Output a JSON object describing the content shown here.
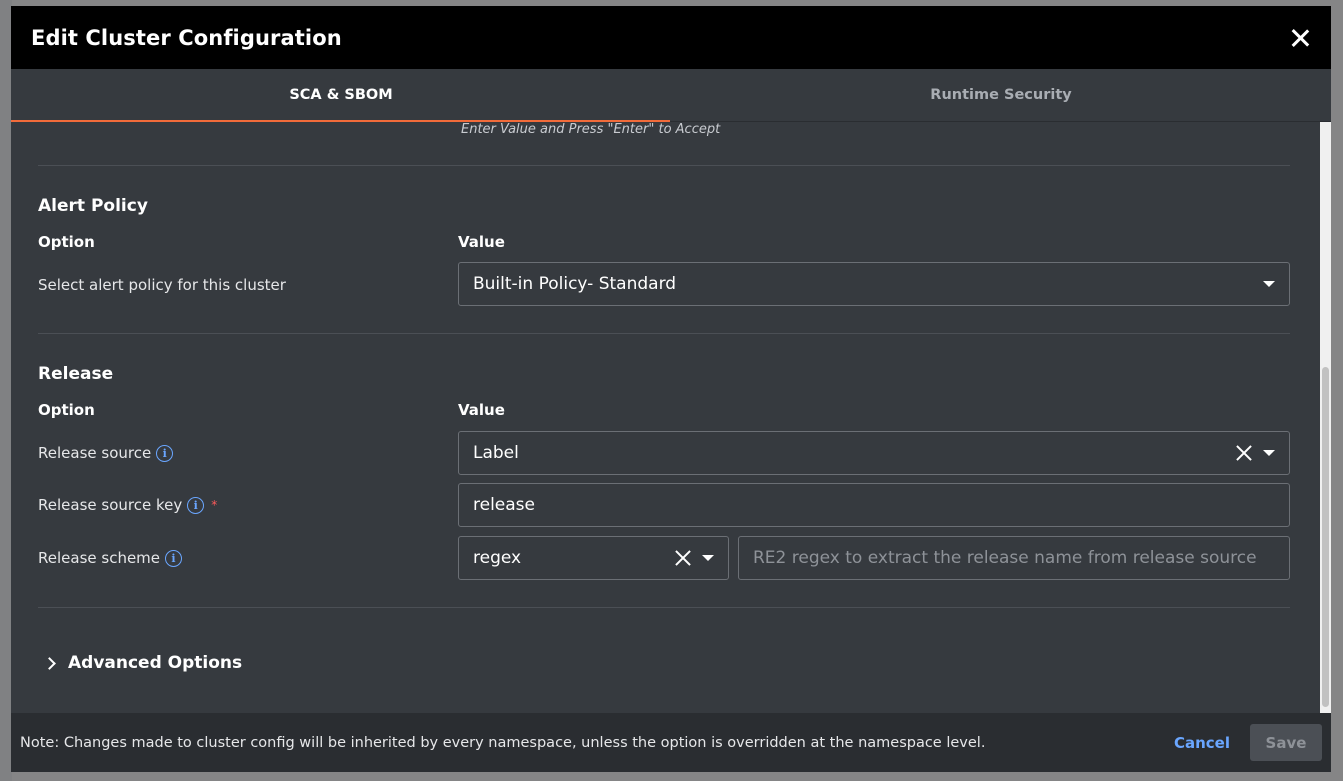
{
  "modal": {
    "title": "Edit Cluster Configuration"
  },
  "tabs": [
    {
      "label": "SCA & SBOM",
      "active": true
    },
    {
      "label": "Runtime Security",
      "active": false
    }
  ],
  "hint": "Enter Value and Press \"Enter\" to Accept",
  "alert_policy": {
    "title": "Alert Policy",
    "option_header": "Option",
    "value_header": "Value",
    "row_label": "Select alert policy for this cluster",
    "selected": "Built-in Policy- Standard"
  },
  "release": {
    "title": "Release",
    "option_header": "Option",
    "value_header": "Value",
    "source_label": "Release source",
    "source_value": "Label",
    "key_label": "Release source key",
    "key_required": "*",
    "key_value": "release",
    "scheme_label": "Release scheme",
    "scheme_value": "regex",
    "regex_placeholder": "RE2 regex to extract the release name from release source"
  },
  "advanced": {
    "label": "Advanced Options"
  },
  "footer": {
    "note": "Note: Changes made to cluster config will be inherited by every namespace, unless the option is overridden at the namespace level.",
    "cancel": "Cancel",
    "save": "Save"
  },
  "colors": {
    "accent_tab": "#f26b3a",
    "link": "#6aa6ff",
    "required": "#ff5a5a",
    "header_bg": "#000000",
    "body_bg": "#363a3f"
  }
}
